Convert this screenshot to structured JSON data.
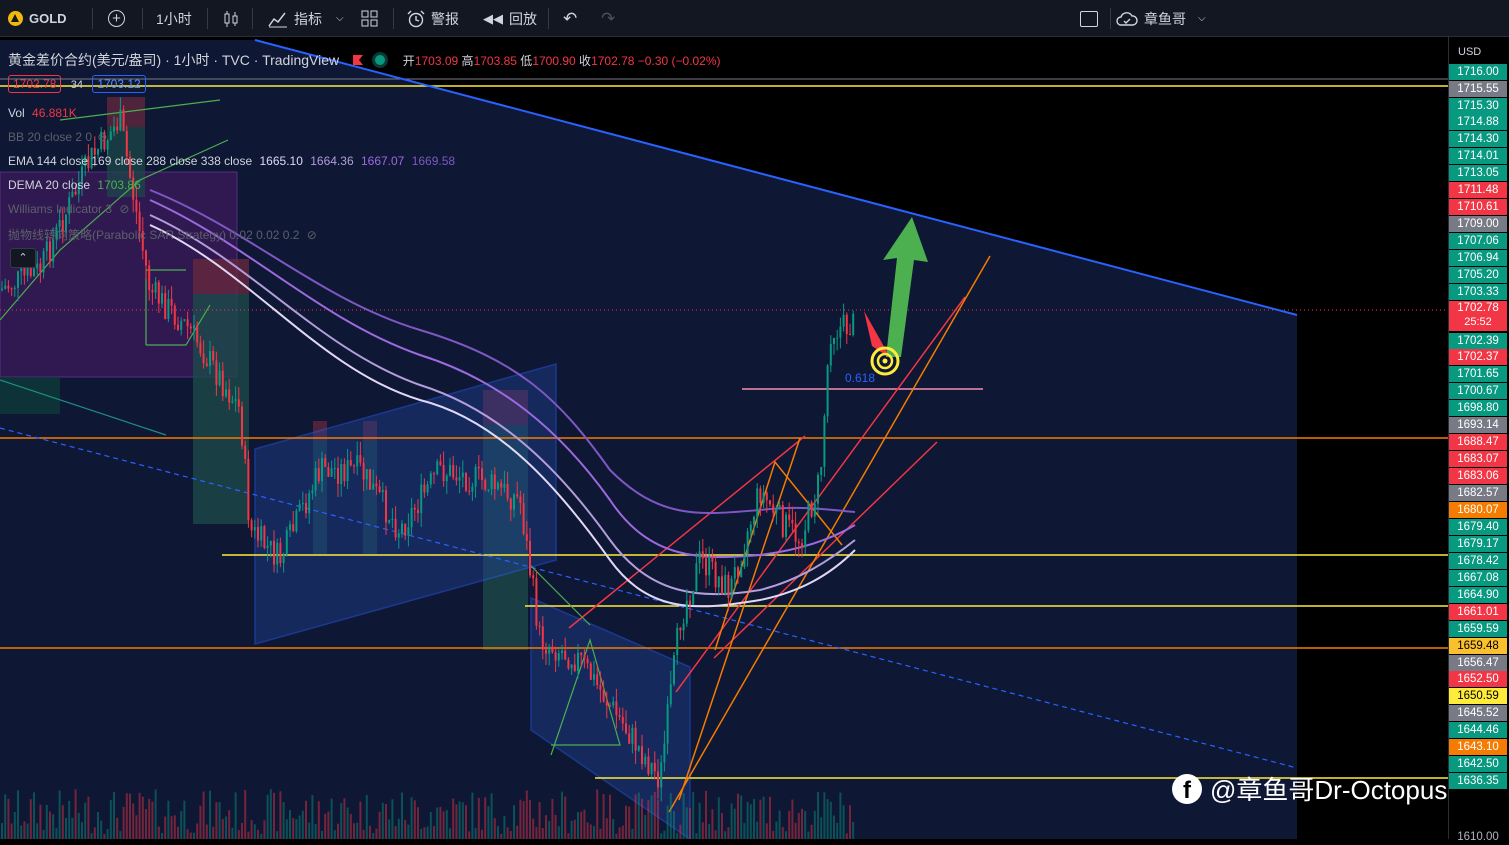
{
  "toolbar": {
    "symbol": "GOLD",
    "interval": "1小时",
    "indicators": "指标",
    "alert": "警报",
    "replay": "回放",
    "user": "章鱼哥"
  },
  "legend": {
    "title": "黄金差价合约(美元/盎司) · 1小时 · TVC · TradingView",
    "ohlc": {
      "o_label": "开",
      "o": "1703.09",
      "h_label": "高",
      "h": "1703.85",
      "l_label": "低",
      "l": "1700.90",
      "c_label": "收",
      "c": "1702.78",
      "chg": "−0.30 (−0.02%)"
    },
    "bid": "1702.78",
    "spread": "34",
    "ask": "1703.12",
    "vol_label": "Vol",
    "vol_value": "46.881K",
    "bb": "BB 20 close 2 0",
    "ema": "EMA 144 close 169 close 288 close 338 close",
    "ema_values": [
      "1665.10",
      "1664.36",
      "1667.07",
      "1669.58"
    ],
    "dema": "DEMA 20 close",
    "dema_value": "1703.86",
    "williams": "Williams Indicator 3",
    "sar": "抛物线转向策略(Parabolic SAR Strategy) 0.02 0.02 0.2",
    "fib_label": "0.618"
  },
  "price_axis": {
    "currency": "USD",
    "labels": [
      {
        "v": "1716.00",
        "bg": "#089981"
      },
      {
        "v": "1715.55",
        "bg": "#787b86"
      },
      {
        "v": "1715.30",
        "bg": "#089981"
      },
      {
        "v": "1714.88",
        "bg": "#089981"
      },
      {
        "v": "1714.30",
        "bg": "#089981"
      },
      {
        "v": "1714.01",
        "bg": "#089981"
      },
      {
        "v": "1713.05",
        "bg": "#089981"
      },
      {
        "v": "1711.48",
        "bg": "#f23645"
      },
      {
        "v": "1710.61",
        "bg": "#f23645"
      },
      {
        "v": "1709.00",
        "bg": "#787b86"
      },
      {
        "v": "1707.06",
        "bg": "#089981"
      },
      {
        "v": "1706.94",
        "bg": "#089981"
      },
      {
        "v": "1705.20",
        "bg": "#089981"
      },
      {
        "v": "1703.33",
        "bg": "#089981"
      },
      {
        "v": "1702.78",
        "bg": "#f23645"
      },
      {
        "v": "1702.39",
        "bg": "#089981"
      },
      {
        "v": "1702.37",
        "bg": "#f23645"
      },
      {
        "v": "1701.65",
        "bg": "#089981"
      },
      {
        "v": "1700.67",
        "bg": "#089981"
      },
      {
        "v": "1698.80",
        "bg": "#089981"
      },
      {
        "v": "1693.14",
        "bg": "#787b86"
      },
      {
        "v": "1688.47",
        "bg": "#f23645"
      },
      {
        "v": "1683.07",
        "bg": "#f23645"
      },
      {
        "v": "1683.06",
        "bg": "#f23645"
      },
      {
        "v": "1682.57",
        "bg": "#787b86"
      },
      {
        "v": "1680.07",
        "bg": "#f57c00"
      },
      {
        "v": "1679.40",
        "bg": "#089981"
      },
      {
        "v": "1679.17",
        "bg": "#089981"
      },
      {
        "v": "1678.42",
        "bg": "#089981"
      },
      {
        "v": "1667.08",
        "bg": "#089981"
      },
      {
        "v": "1664.90",
        "bg": "#089981"
      },
      {
        "v": "1661.01",
        "bg": "#f23645"
      },
      {
        "v": "1659.59",
        "bg": "#089981"
      },
      {
        "v": "1659.48",
        "bg": "#fbc02d"
      },
      {
        "v": "1656.47",
        "bg": "#787b86"
      },
      {
        "v": "1652.50",
        "bg": "#f23645"
      },
      {
        "v": "1650.59",
        "bg": "#ffeb3b"
      },
      {
        "v": "1645.52",
        "bg": "#787b86"
      },
      {
        "v": "1644.46",
        "bg": "#089981"
      },
      {
        "v": "1643.10",
        "bg": "#f57c00"
      },
      {
        "v": "1642.50",
        "bg": "#089981"
      },
      {
        "v": "1636.35",
        "bg": "#089981"
      },
      {
        "v": "1610.00",
        "bg": "#000000"
      }
    ],
    "countdown": "25:52"
  },
  "watermark": "@章鱼哥Dr-Octopus",
  "colors": {
    "up": "#089981",
    "down": "#f23645",
    "trend_blue": "#2962ff",
    "hline_yellow": "#ffeb3b",
    "hline_orange": "#f57c00",
    "arrow_green": "#4caf50",
    "arrow_red": "#f23645"
  }
}
